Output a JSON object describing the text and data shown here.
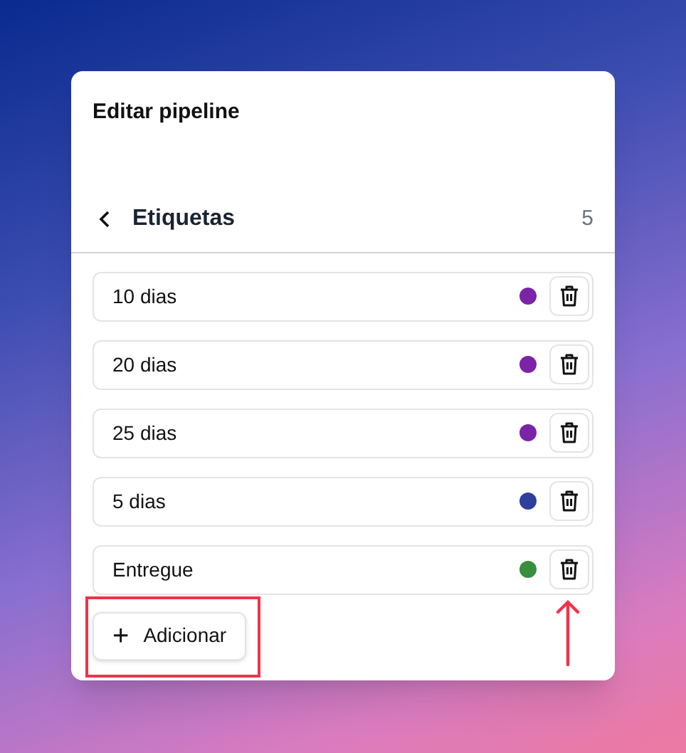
{
  "dialog": {
    "title": "Editar pipeline"
  },
  "section": {
    "title": "Etiquetas",
    "count": "5"
  },
  "tags": [
    {
      "label": "10 dias",
      "color": "#7b24a8"
    },
    {
      "label": "20 dias",
      "color": "#7b24a8"
    },
    {
      "label": "25 dias",
      "color": "#7b24a8"
    },
    {
      "label": "5 dias",
      "color": "#2f3f9e"
    },
    {
      "label": "Entregue",
      "color": "#388e3c"
    }
  ],
  "add_button": {
    "icon": "+",
    "label": "Adicionar"
  }
}
